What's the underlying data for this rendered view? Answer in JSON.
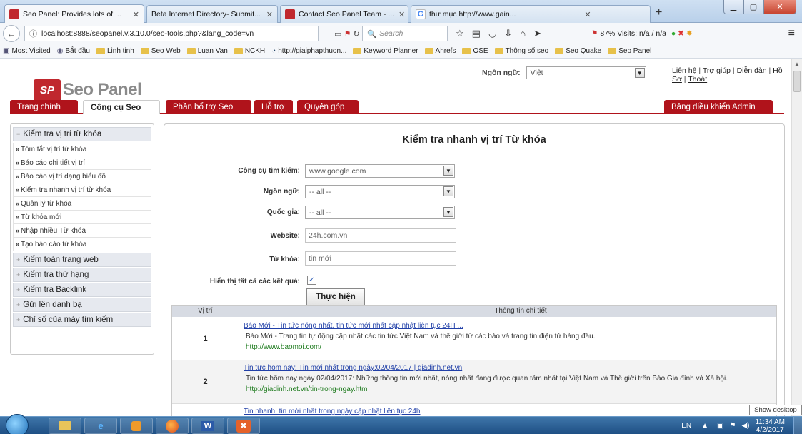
{
  "browser": {
    "tabs": [
      {
        "title": "Seo Panel: Provides lots of ...",
        "icon": "seopanel-favicon"
      },
      {
        "title": "Beta Internet Directory- Submit...",
        "icon": "none"
      },
      {
        "title": "Contact Seo Panel Team - ...",
        "icon": "seopanel-favicon"
      },
      {
        "title": "thư mục http://www.gain...",
        "icon": "google-favicon"
      }
    ],
    "url": "localhost:8888/seopanel.v.3.10.0/seo-tools.php?&lang_code=vn",
    "search_placeholder": "Search",
    "stats": "87%  Visits: n/a / n/a",
    "bookmarks": [
      "Most Visited",
      "Bắt đầu",
      "Linh tinh",
      "Seo Web",
      "Luan Van",
      "NCKH",
      "http://giaiphapthuon...",
      "Keyword Planner",
      "Ahrefs",
      "OSE",
      "Thông số seo",
      "Seo Quake",
      "Seo Panel"
    ]
  },
  "header": {
    "logo_text": "Seo Panel",
    "logo_mark": "SP",
    "language_label": "Ngôn ngữ:",
    "language_value": "Việt",
    "links": [
      "Liên hệ",
      "Trợ giúp",
      "Diễn đàn",
      "Hồ Sơ",
      "Thoát"
    ]
  },
  "menu": {
    "items": [
      "Trang chính",
      "Công cụ Seo",
      "Phần bổ trợ Seo",
      "Hỗ trợ",
      "Quyên góp"
    ],
    "right": "Bảng điều khiển Admin"
  },
  "sidebar": {
    "sections": [
      "Kiểm tra vị trí từ khóa",
      "Kiểm toán trang web",
      "Kiểm tra thứ hạng",
      "Kiểm tra Backlink",
      "Gửi lên danh bạ",
      "Chỉ số của máy tìm kiếm"
    ],
    "subitems": [
      "Tóm tắt vị trí từ khóa",
      "Báo cáo chi tiết vị trí",
      "Báo cáo vị trí dạng biểu đồ",
      "Kiểm tra nhanh vị trí từ khóa",
      "Quản lý từ khóa",
      "Từ khóa mới",
      "Nhập nhiều Từ khóa",
      "Tạo báo cáo từ khóa"
    ]
  },
  "form": {
    "title": "Kiểm tra nhanh vị trí Từ khóa",
    "search_engine_label": "Công cụ tìm kiếm:",
    "search_engine_value": "www.google.com",
    "language_label": "Ngôn ngữ:",
    "language_value": "-- all --",
    "country_label": "Quốc gia:",
    "country_value": "-- all --",
    "website_label": "Website:",
    "website_value": "24h.com.vn",
    "keyword_label": "Từ khóa:",
    "keyword_value": "tin mới",
    "show_all_label": "Hiển thị tất cả các kết quả:",
    "show_all_checked": true,
    "submit_label": "Thực hiện"
  },
  "results": {
    "col_position": "Vị trí",
    "col_detail": "Thông tin chi tiết",
    "rows": [
      {
        "pos": "1",
        "title": "Báo Mới - Tin tức nóng nhất, tin tức mới nhất cập nhật liên tục 24H ...",
        "desc": "Báo Mới - Trang tin tự động cập nhật các tin tức Việt Nam và thế giới từ các báo và trang tin điện tử hàng đầu.",
        "url": "http://www.baomoi.com/"
      },
      {
        "pos": "2",
        "title": "Tin tưc hom nay: Tin mới nhất trong ngày:02/04/2017 | giadinh.net.vn",
        "desc": "Tin tức hôm nay ngày 02/04/2017: Những thông tin mới nhất, nóng nhất đang được quan tâm nhất tại Việt Nam và Thế giới trên Báo Gia đình và Xã hội.",
        "url": "http://giadinh.net.vn/tin-trong-ngay.htm"
      },
      {
        "pos": "",
        "title": "Tin nhanh, tin mới nhất trong ngày cập nhật liên tục 24h",
        "desc": "",
        "url": ""
      }
    ]
  },
  "taskbar": {
    "show_desktop": "Show desktop",
    "lang": "EN",
    "time": "11:34 AM",
    "date": "4/2/2017"
  }
}
